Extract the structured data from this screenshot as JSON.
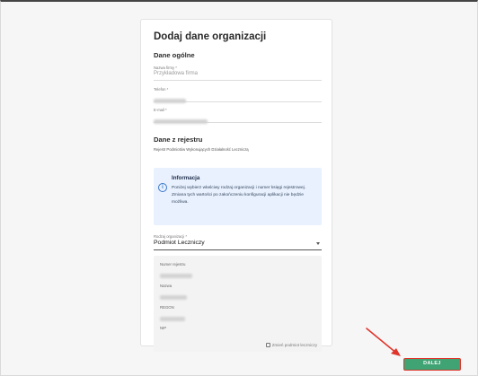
{
  "form": {
    "title": "Dodaj dane organizacji",
    "general_section": {
      "title": "Dane ogólne",
      "company_name": {
        "label": "Nazwa firmy *",
        "placeholder": "Przykładowa firma"
      },
      "phone": {
        "label": "Telefon *"
      },
      "email": {
        "label": "E-mail *"
      }
    },
    "registry_section": {
      "title": "Dane z rejestru",
      "registry_name": "Rejestr Podmiotów Wykonujących Działalność Leczniczą"
    },
    "info": {
      "title": "Informacja",
      "text": "Poniżej wybierz właściwy rodzaj organizacji i numer księgi rejestrowej. Zmiana tych wartości po zakończeniu konfiguracji aplikacji nie będzie możliwa."
    },
    "org_type": {
      "label": "Rodzaj organizacji *",
      "value": "Podmiot Leczniczy"
    },
    "registry_details": {
      "registry_number_label": "Numer rejestru",
      "name_label": "Nazwa",
      "regon_label": "REGON",
      "nip_label": "NIP",
      "change_label": "Zmień podmiot leczniczy"
    }
  },
  "actions": {
    "next_label": "DALEJ"
  },
  "colors": {
    "next_button": "#3fa374",
    "highlight": "#e0352b",
    "info_background": "#e8f1fd"
  }
}
